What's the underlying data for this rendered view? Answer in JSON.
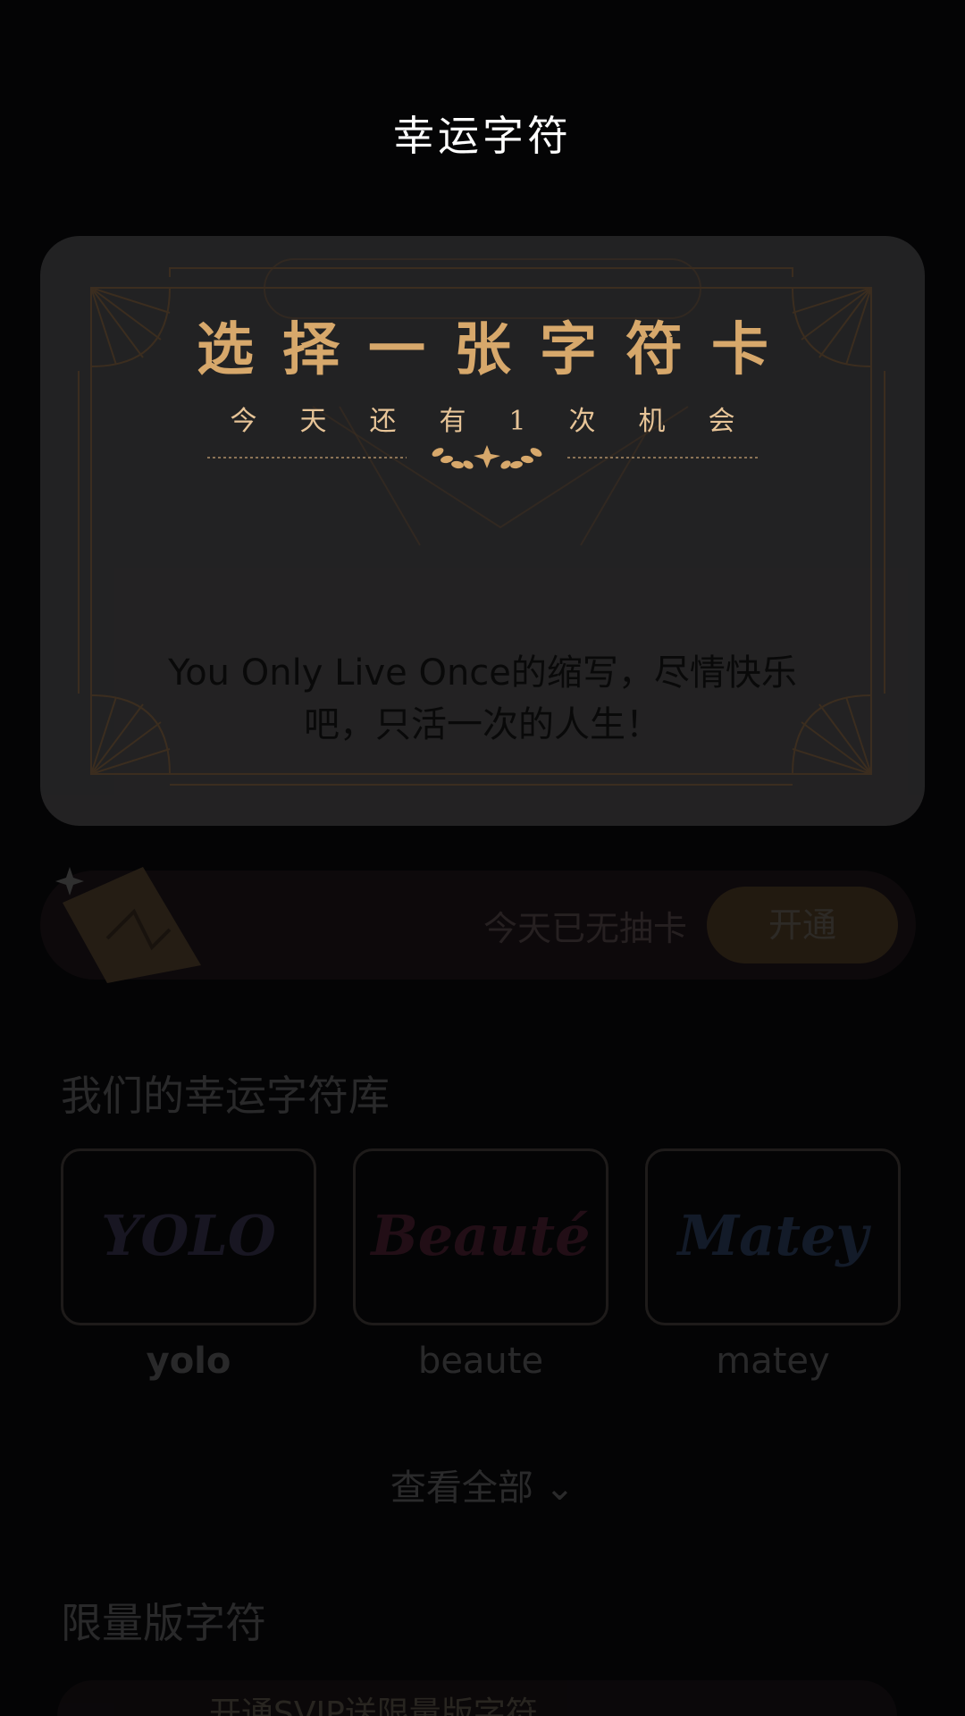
{
  "header": {
    "title": "幸运字符"
  },
  "card": {
    "heading": "选择一张字符卡",
    "subheading": "今天还有1次机会",
    "description": "You Only Live Once的缩写，尽情快乐吧，只活一次的人生！"
  },
  "draw_bar": {
    "status": "今天已无抽卡",
    "button_label": "开通"
  },
  "library": {
    "title": "我们的幸运字符库",
    "items": [
      {
        "name": "yolo",
        "logo": "YOLO",
        "color": "#7a6fb0"
      },
      {
        "name": "beaute",
        "logo": "Beauté",
        "color": "#b8416a"
      },
      {
        "name": "matey",
        "logo": "Matey",
        "color": "#5c8ad9"
      }
    ],
    "see_all": "查看全部"
  },
  "limited": {
    "title": "限量版字符",
    "banner_text": "开通SVIP送限量版字符"
  },
  "colors": {
    "gold": "#d7a86b",
    "background": "#040405"
  }
}
